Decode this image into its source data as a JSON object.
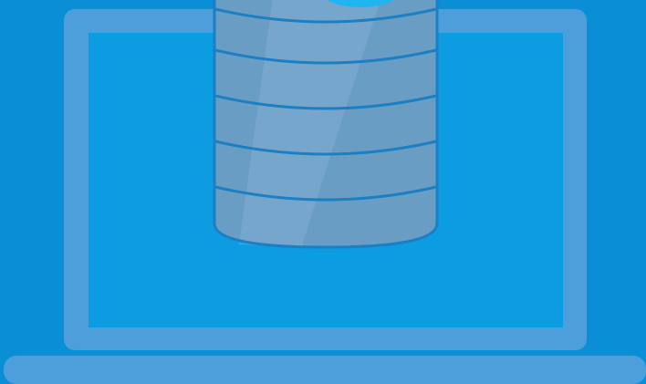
{
  "illustration": {
    "subject": "laptop-with-database",
    "colors": {
      "background": "#0a8fd6",
      "background_light": "#17a0e3",
      "laptop_frame": "#4d9fdb",
      "laptop_screen": "#0b9ce2",
      "database_body": "#6a9dc4",
      "database_band": "#1b7fc4",
      "database_top": "#1fb5f0"
    },
    "icons": [
      "laptop-icon",
      "database-icon"
    ]
  }
}
